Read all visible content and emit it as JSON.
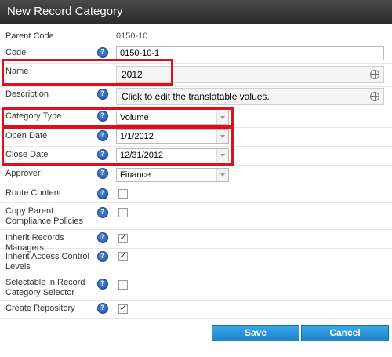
{
  "dialog": {
    "title": "New Record Category"
  },
  "fields": {
    "parent_code": {
      "label": "Parent Code",
      "value": "0150-10"
    },
    "code": {
      "label": "Code",
      "value": "0150-10-1"
    },
    "name": {
      "label": "Name",
      "value": "2012"
    },
    "description": {
      "label": "Description",
      "value": "Click to edit the translatable values."
    },
    "category_type": {
      "label": "Category Type",
      "value": "Volume"
    },
    "open_date": {
      "label": "Open Date",
      "value": "1/1/2012"
    },
    "close_date": {
      "label": "Close Date",
      "value": "12/31/2012"
    },
    "approver": {
      "label": "Approver",
      "value": "Finance"
    },
    "route_content": {
      "label": "Route Content",
      "checked": false
    },
    "copy_parent_compliance": {
      "label": "Copy Parent Compliance Policies",
      "checked": false
    },
    "inherit_records_managers": {
      "label": "Inherit Records Managers",
      "checked": true
    },
    "inherit_access_control": {
      "label": "Inherit Access Control Levels",
      "checked": true
    },
    "selectable_in_selector": {
      "label": "Selectable in Record Category Selector",
      "checked": false
    },
    "create_repository": {
      "label": "Create Repository",
      "checked": true
    }
  },
  "help_glyph": "?",
  "check_glyph": "✓",
  "buttons": {
    "save": "Save",
    "cancel": "Cancel"
  },
  "icons": {
    "help": "help-icon",
    "globe": "globe-icon",
    "dropdown": "chevron-down-icon"
  },
  "colors": {
    "highlight": "#e0101a",
    "button": "#1b84cc",
    "titlebar": "#333333"
  }
}
